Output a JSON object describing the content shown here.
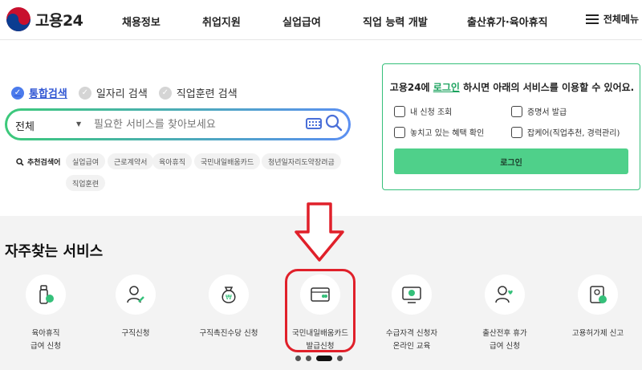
{
  "header": {
    "logo_text": "고용24",
    "nav": [
      "채용정보",
      "취업지원",
      "실업급여",
      "직업 능력 개발",
      "출산휴가·육아휴직"
    ],
    "menu_all": "전체메뉴"
  },
  "search": {
    "tabs": [
      {
        "label": "통합검색",
        "active": true
      },
      {
        "label": "일자리 검색",
        "active": false
      },
      {
        "label": "직업훈련 검색",
        "active": false
      }
    ],
    "scope": "전체",
    "placeholder": "필요한 서비스를 찾아보세요",
    "recommended_label": "추천검색어",
    "recommended": [
      "실업급여",
      "근로계약서",
      "육아휴직",
      "국민내일배움카드",
      "청년일자리도약장려금",
      "직업훈련"
    ]
  },
  "login_panel": {
    "message_pre": "고용24에 ",
    "message_link": "로그인",
    "message_post": " 하시면 아래의 서비스를 이용할 수 있어요.",
    "links": [
      "내 신청 조회",
      "증명서 발급",
      "놓치고 있는 혜택 확인",
      "잡케어(직업추천, 경력관리)"
    ],
    "button": "로그인"
  },
  "services": {
    "title": "자주찾는 서비스",
    "items": [
      {
        "label1": "육아휴직",
        "label2": "급여 신청",
        "icon": "baby-bottle-icon"
      },
      {
        "label1": "구직신청",
        "label2": "",
        "icon": "person-edit-icon"
      },
      {
        "label1": "구직촉진수당 신청",
        "label2": "",
        "icon": "money-bag-icon"
      },
      {
        "label1": "국민내일배움카드",
        "label2": "발급신청",
        "icon": "card-icon"
      },
      {
        "label1": "수급자격 신청자",
        "label2": "온라인 교육",
        "icon": "monitor-play-icon"
      },
      {
        "label1": "출산전후 휴가",
        "label2": "급여 신청",
        "icon": "person-heart-icon"
      },
      {
        "label1": "고용허가제 신고",
        "label2": "",
        "icon": "badge-check-icon"
      }
    ],
    "carousel_pages": 4,
    "carousel_active": 3
  },
  "colors": {
    "accent_green": "#35c07a",
    "accent_blue": "#4b7bec",
    "annotation_red": "#e0202a"
  }
}
